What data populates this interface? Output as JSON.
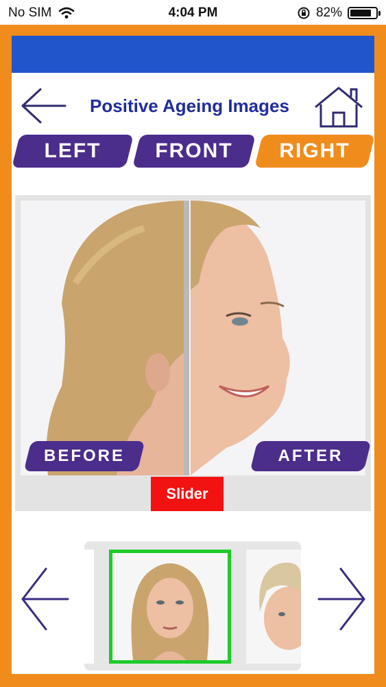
{
  "status_bar": {
    "carrier": "No SIM",
    "time": "4:04 PM",
    "battery_percent": "82%",
    "battery_level": 0.82
  },
  "header": {
    "title": "Positive Ageing Images",
    "back_icon": "arrow-left-icon",
    "home_icon": "home-icon"
  },
  "tabs": [
    {
      "label": "LEFT",
      "active": false
    },
    {
      "label": "FRONT",
      "active": false
    },
    {
      "label": "RIGHT",
      "active": true
    }
  ],
  "comparison": {
    "before_label": "BEFORE",
    "after_label": "AFTER",
    "slider_label": "Slider"
  },
  "carousel": {
    "prev_icon": "arrow-left-icon",
    "next_icon": "arrow-right-icon"
  },
  "colors": {
    "frame": "#F08C1C",
    "top_bar": "#2155CC",
    "tab_inactive": "#4B2D8C",
    "tab_active": "#F08C1C",
    "title": "#1F2C9C",
    "slider": "#F21212",
    "selected_border": "#1DCB29"
  }
}
